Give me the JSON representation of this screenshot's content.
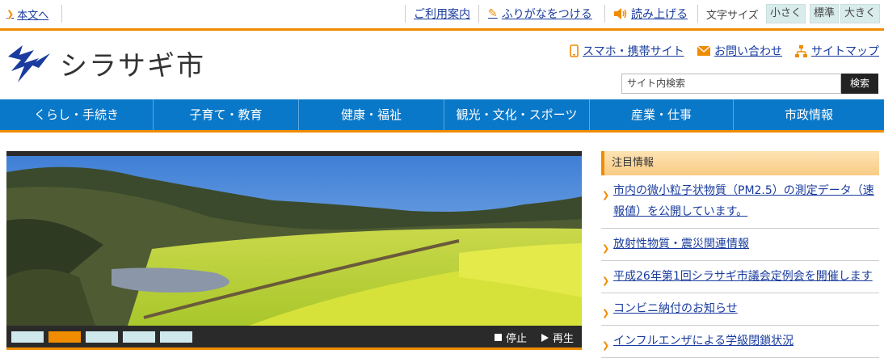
{
  "utility": {
    "skip_label": "本文へ",
    "guide_label": "ご利用案内",
    "furigana_label": "ふりがなをつける",
    "readaloud_label": "読み上げる",
    "fontsize_label": "文字サイズ",
    "fontsize_options": [
      "小さく",
      "標準",
      "大きく"
    ]
  },
  "header": {
    "site_name": "シラサギ市",
    "links": [
      "スマホ・携帯サイト",
      "お問い合わせ",
      "サイトマップ"
    ],
    "search_placeholder": "サイト内検索",
    "search_button": "検索"
  },
  "nav": [
    "くらし・手続き",
    "子育て・教育",
    "健康・福祉",
    "観光・文化・スポーツ",
    "産業・仕事",
    "市政情報"
  ],
  "slideshow": {
    "slide_count": 5,
    "active_index": 1,
    "stop_label": "停止",
    "play_label": "再生"
  },
  "featured": {
    "heading": "注目情報",
    "items": [
      "市内の微小粒子状物質（PM2.5）の測定データ（速報値）を公開しています。",
      "放射性物質・震災関連情報",
      "平成26年第1回シラサギ市議会定例会を開催します",
      "コンビニ納付のお知らせ",
      "インフルエンザによる学級閉鎖状況"
    ]
  },
  "colors": {
    "accent": "#f08c00",
    "nav_blue": "#0a78c8",
    "link": "#1a3c9e"
  }
}
